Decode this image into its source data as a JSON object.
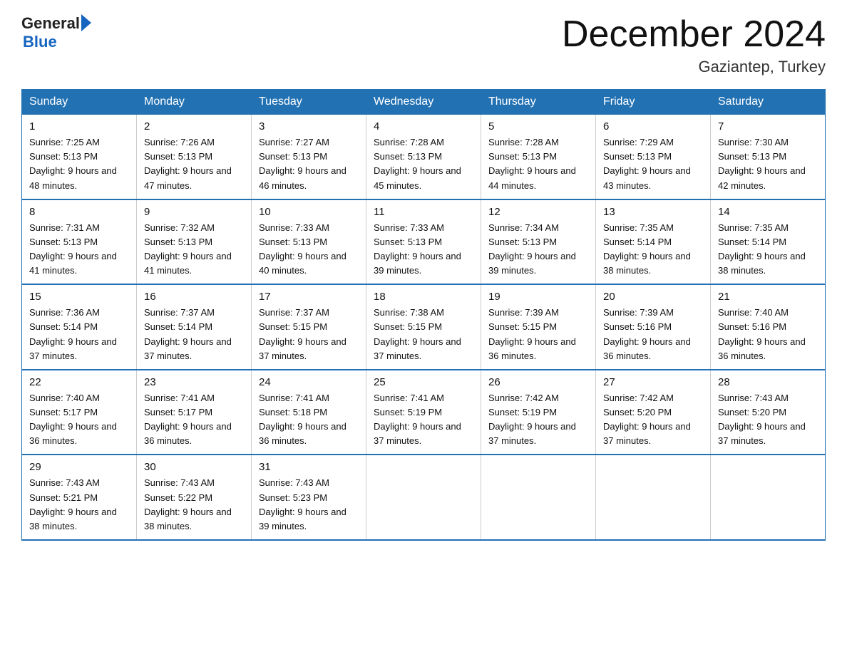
{
  "logo": {
    "text_general": "General",
    "text_blue": "Blue"
  },
  "title": "December 2024",
  "subtitle": "Gaziantep, Turkey",
  "days_of_week": [
    "Sunday",
    "Monday",
    "Tuesday",
    "Wednesday",
    "Thursday",
    "Friday",
    "Saturday"
  ],
  "weeks": [
    [
      {
        "day": "1",
        "sunrise": "7:25 AM",
        "sunset": "5:13 PM",
        "daylight": "9 hours and 48 minutes."
      },
      {
        "day": "2",
        "sunrise": "7:26 AM",
        "sunset": "5:13 PM",
        "daylight": "9 hours and 47 minutes."
      },
      {
        "day": "3",
        "sunrise": "7:27 AM",
        "sunset": "5:13 PM",
        "daylight": "9 hours and 46 minutes."
      },
      {
        "day": "4",
        "sunrise": "7:28 AM",
        "sunset": "5:13 PM",
        "daylight": "9 hours and 45 minutes."
      },
      {
        "day": "5",
        "sunrise": "7:28 AM",
        "sunset": "5:13 PM",
        "daylight": "9 hours and 44 minutes."
      },
      {
        "day": "6",
        "sunrise": "7:29 AM",
        "sunset": "5:13 PM",
        "daylight": "9 hours and 43 minutes."
      },
      {
        "day": "7",
        "sunrise": "7:30 AM",
        "sunset": "5:13 PM",
        "daylight": "9 hours and 42 minutes."
      }
    ],
    [
      {
        "day": "8",
        "sunrise": "7:31 AM",
        "sunset": "5:13 PM",
        "daylight": "9 hours and 41 minutes."
      },
      {
        "day": "9",
        "sunrise": "7:32 AM",
        "sunset": "5:13 PM",
        "daylight": "9 hours and 41 minutes."
      },
      {
        "day": "10",
        "sunrise": "7:33 AM",
        "sunset": "5:13 PM",
        "daylight": "9 hours and 40 minutes."
      },
      {
        "day": "11",
        "sunrise": "7:33 AM",
        "sunset": "5:13 PM",
        "daylight": "9 hours and 39 minutes."
      },
      {
        "day": "12",
        "sunrise": "7:34 AM",
        "sunset": "5:13 PM",
        "daylight": "9 hours and 39 minutes."
      },
      {
        "day": "13",
        "sunrise": "7:35 AM",
        "sunset": "5:14 PM",
        "daylight": "9 hours and 38 minutes."
      },
      {
        "day": "14",
        "sunrise": "7:35 AM",
        "sunset": "5:14 PM",
        "daylight": "9 hours and 38 minutes."
      }
    ],
    [
      {
        "day": "15",
        "sunrise": "7:36 AM",
        "sunset": "5:14 PM",
        "daylight": "9 hours and 37 minutes."
      },
      {
        "day": "16",
        "sunrise": "7:37 AM",
        "sunset": "5:14 PM",
        "daylight": "9 hours and 37 minutes."
      },
      {
        "day": "17",
        "sunrise": "7:37 AM",
        "sunset": "5:15 PM",
        "daylight": "9 hours and 37 minutes."
      },
      {
        "day": "18",
        "sunrise": "7:38 AM",
        "sunset": "5:15 PM",
        "daylight": "9 hours and 37 minutes."
      },
      {
        "day": "19",
        "sunrise": "7:39 AM",
        "sunset": "5:15 PM",
        "daylight": "9 hours and 36 minutes."
      },
      {
        "day": "20",
        "sunrise": "7:39 AM",
        "sunset": "5:16 PM",
        "daylight": "9 hours and 36 minutes."
      },
      {
        "day": "21",
        "sunrise": "7:40 AM",
        "sunset": "5:16 PM",
        "daylight": "9 hours and 36 minutes."
      }
    ],
    [
      {
        "day": "22",
        "sunrise": "7:40 AM",
        "sunset": "5:17 PM",
        "daylight": "9 hours and 36 minutes."
      },
      {
        "day": "23",
        "sunrise": "7:41 AM",
        "sunset": "5:17 PM",
        "daylight": "9 hours and 36 minutes."
      },
      {
        "day": "24",
        "sunrise": "7:41 AM",
        "sunset": "5:18 PM",
        "daylight": "9 hours and 36 minutes."
      },
      {
        "day": "25",
        "sunrise": "7:41 AM",
        "sunset": "5:19 PM",
        "daylight": "9 hours and 37 minutes."
      },
      {
        "day": "26",
        "sunrise": "7:42 AM",
        "sunset": "5:19 PM",
        "daylight": "9 hours and 37 minutes."
      },
      {
        "day": "27",
        "sunrise": "7:42 AM",
        "sunset": "5:20 PM",
        "daylight": "9 hours and 37 minutes."
      },
      {
        "day": "28",
        "sunrise": "7:43 AM",
        "sunset": "5:20 PM",
        "daylight": "9 hours and 37 minutes."
      }
    ],
    [
      {
        "day": "29",
        "sunrise": "7:43 AM",
        "sunset": "5:21 PM",
        "daylight": "9 hours and 38 minutes."
      },
      {
        "day": "30",
        "sunrise": "7:43 AM",
        "sunset": "5:22 PM",
        "daylight": "9 hours and 38 minutes."
      },
      {
        "day": "31",
        "sunrise": "7:43 AM",
        "sunset": "5:23 PM",
        "daylight": "9 hours and 39 minutes."
      },
      null,
      null,
      null,
      null
    ]
  ]
}
